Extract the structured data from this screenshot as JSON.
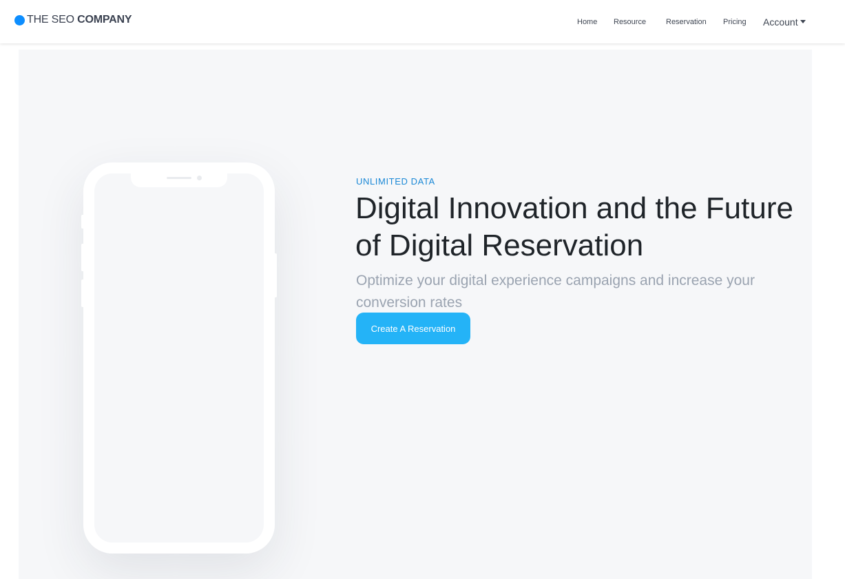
{
  "brand": {
    "prefix": "THE SEO ",
    "bold": "COMPANY",
    "dot_color": "#0d8eff"
  },
  "nav": {
    "items": [
      {
        "label": "Home"
      },
      {
        "label": "Resource"
      },
      {
        "label": "Reservation"
      },
      {
        "label": "Pricing"
      }
    ],
    "account_label": "Account"
  },
  "hero": {
    "eyebrow": "UNLIMITED DATA",
    "headline_light": "Digital Innovation and the ",
    "headline_strong_1": "Future",
    "headline_strong_2": "of Digital Reservation",
    "subtitle": "Optimize your digital experience campaigns and increase your conversion rates",
    "cta_label": "Create A Reservation",
    "accent_color": "#24b3f7",
    "eyebrow_color": "#1a88d6"
  }
}
